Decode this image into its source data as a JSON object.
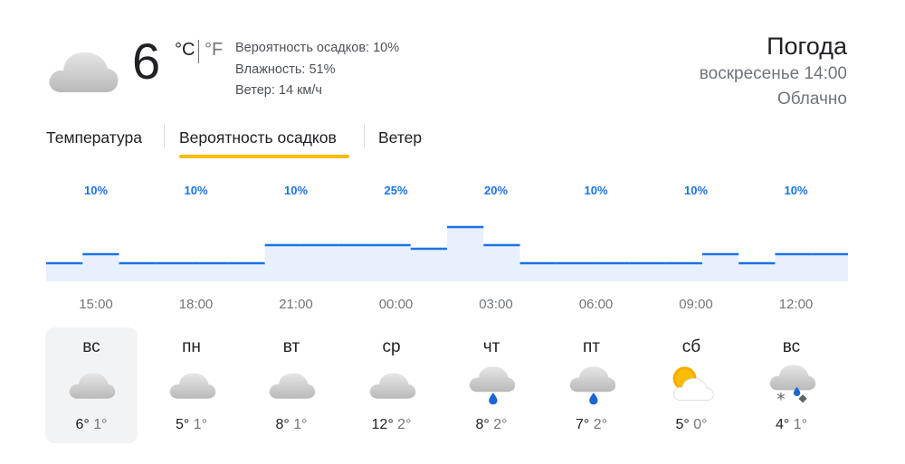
{
  "current": {
    "icon": "cloud-icon",
    "temp": "6",
    "unit_c": "°C",
    "unit_f": "°F",
    "details": [
      "Вероятность осадков: 10%",
      "Влажность: 51%",
      "Ветер: 14 км/ч"
    ]
  },
  "location": {
    "title": "Погода",
    "datetime": "воскресенье 14:00",
    "condition": "Облачно"
  },
  "tabs": [
    {
      "label": "Температура",
      "active": false
    },
    {
      "label": "Вероятность осадков",
      "active": true
    },
    {
      "label": "Ветер",
      "active": false
    }
  ],
  "colors": {
    "accent": "#fbbc04",
    "line": "#1a73e8",
    "fill": "#e8f0fe"
  },
  "chart_data": {
    "type": "area",
    "x": [
      "15:00",
      "18:00",
      "21:00",
      "00:00",
      "03:00",
      "06:00",
      "09:00",
      "12:00"
    ],
    "labels": [
      "10%",
      "10%",
      "10%",
      "25%",
      "20%",
      "10%",
      "10%",
      "10%"
    ],
    "values": [
      10,
      15,
      10,
      10,
      10,
      10,
      20,
      20,
      20,
      20,
      18,
      30,
      20,
      10,
      10,
      10,
      10,
      10,
      15,
      10,
      15,
      15
    ],
    "ylim": [
      0,
      100
    ]
  },
  "days": [
    {
      "name": "вс",
      "icon": "cloud-icon",
      "max": "6°",
      "min": "1°",
      "selected": true
    },
    {
      "name": "пн",
      "icon": "cloud-icon",
      "max": "5°",
      "min": "1°",
      "selected": false
    },
    {
      "name": "вт",
      "icon": "cloud-icon",
      "max": "8°",
      "min": "1°",
      "selected": false
    },
    {
      "name": "ср",
      "icon": "cloud-icon",
      "max": "12°",
      "min": "2°",
      "selected": false
    },
    {
      "name": "чт",
      "icon": "rain-icon",
      "max": "8°",
      "min": "2°",
      "selected": false
    },
    {
      "name": "пт",
      "icon": "rain-icon",
      "max": "7°",
      "min": "2°",
      "selected": false
    },
    {
      "name": "сб",
      "icon": "partly-cloudy-icon",
      "max": "5°",
      "min": "0°",
      "selected": false
    },
    {
      "name": "вс",
      "icon": "snow-rain-icon",
      "max": "4°",
      "min": "1°",
      "selected": false
    }
  ]
}
